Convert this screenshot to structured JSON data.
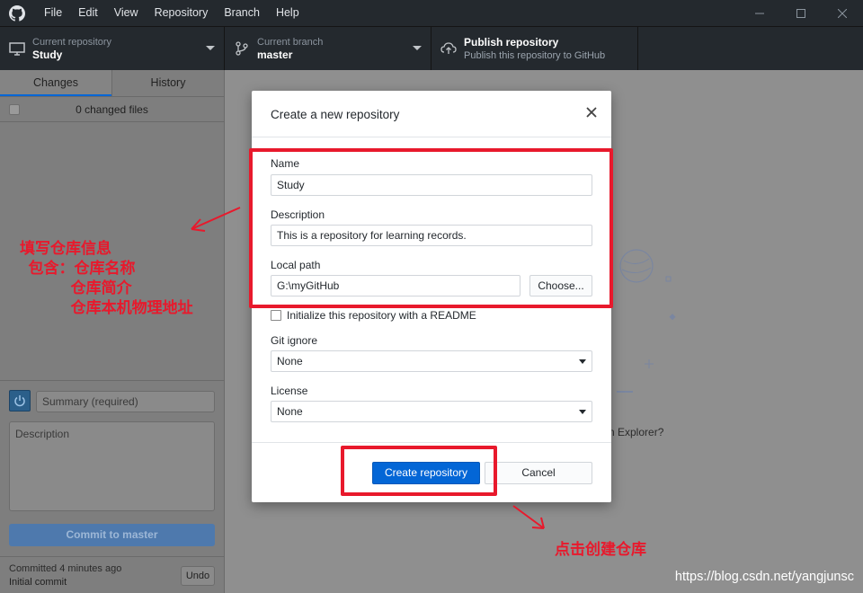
{
  "menu": [
    "File",
    "Edit",
    "View",
    "Repository",
    "Branch",
    "Help"
  ],
  "toolbar": {
    "repo_label": "Current repository",
    "repo_value": "Study",
    "branch_label": "Current branch",
    "branch_value": "master",
    "publish_title": "Publish repository",
    "publish_sub": "Publish this repository to GitHub"
  },
  "sidebar": {
    "tabs": [
      "Changes",
      "History"
    ],
    "changed_files": "0 changed files",
    "summary_placeholder": "Summary (required)",
    "description_placeholder": "Description",
    "commit_button": "Commit to master",
    "last_commit_meta": "Committed 4 minutes ago",
    "last_commit_msg": "Initial commit",
    "undo": "Undo"
  },
  "main": {
    "explorer_text": "n Explorer?"
  },
  "dialog": {
    "title": "Create a new repository",
    "name_label": "Name",
    "name_value": "Study",
    "description_label": "Description",
    "description_value": "This is a repository for learning records.",
    "local_path_label": "Local path",
    "local_path_value": "G:\\myGitHub",
    "choose_button": "Choose...",
    "readme_label": "Initialize this repository with a README",
    "gitignore_label": "Git ignore",
    "gitignore_value": "None",
    "license_label": "License",
    "license_value": "None",
    "create_button": "Create repository",
    "cancel_button": "Cancel"
  },
  "annotations": {
    "left_note": "填写仓库信息\n  包含：仓库名称\n            仓库简介\n            仓库本机物理地址",
    "bottom_note": "点击创建仓库",
    "watermark": "https://blog.csdn.net/yangjunsc"
  },
  "colors": {
    "accent": "#0366d6",
    "annotation_red": "#e8192c",
    "titlebar": "#24292e"
  }
}
